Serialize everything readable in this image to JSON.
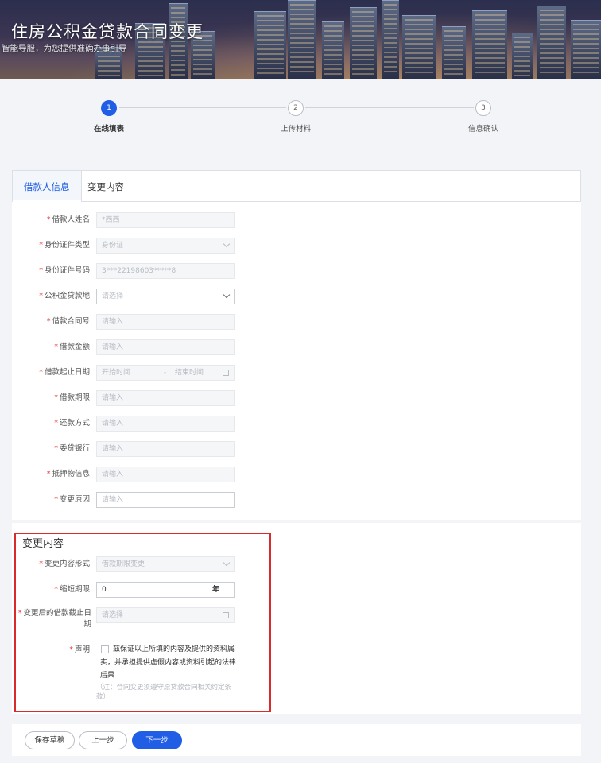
{
  "header": {
    "title": "住房公积金贷款合同变更",
    "subtitle": "智能导服，为您提供准确办事引导"
  },
  "steps": [
    {
      "index": "1",
      "label": "在线填表",
      "state": "active"
    },
    {
      "index": "2",
      "label": "上传材料",
      "state": "pending"
    },
    {
      "index": "3",
      "label": "信息确认",
      "state": "pending"
    }
  ],
  "tabs": [
    {
      "label": "借款人信息",
      "active": true
    },
    {
      "label": "变更内容",
      "active": false
    }
  ],
  "borrower_form": {
    "name": {
      "label": "借款人姓名",
      "value": "*西西"
    },
    "id_type": {
      "label": "身份证件类型",
      "value": "身份证"
    },
    "id_number": {
      "label": "身份证件号码",
      "value": "3***22198603*****8"
    },
    "fund_location": {
      "label": "公积金贷款地",
      "placeholder": "请选择"
    },
    "contract_no": {
      "label": "借款合同号",
      "placeholder": "请输入"
    },
    "loan_amount": {
      "label": "借款金额",
      "placeholder": "请输入"
    },
    "loan_dates": {
      "label": "借款起止日期",
      "start_placeholder": "开始时间",
      "separator": "-",
      "end_placeholder": "结束时间"
    },
    "loan_term": {
      "label": "借款期限",
      "placeholder": "请输入"
    },
    "repay_method": {
      "label": "还款方式",
      "placeholder": "请输入"
    },
    "entrusted_bank": {
      "label": "委贷银行",
      "placeholder": "请输入"
    },
    "collateral": {
      "label": "抵押物信息",
      "placeholder": "请输入"
    },
    "change_reason": {
      "label": "变更原因",
      "placeholder": "请输入"
    }
  },
  "change_section": {
    "title": "变更内容",
    "change_form": {
      "label": "变更内容形式",
      "value": "借款期限变更"
    },
    "shorten_term": {
      "label": "缩短期限",
      "value": "0",
      "unit": "年"
    },
    "new_end_date": {
      "label": "变更后的借款截止日期",
      "placeholder": "请选择"
    },
    "declaration": {
      "label": "声明",
      "text": "兹保证以上所填的内容及提供的资料属实，并承担提供虚假内容或资料引起的法律后果",
      "checked": false,
      "note": "（注：合同变更须遵守原贷款合同相关约定条款）"
    }
  },
  "footer": {
    "save_draft": "保存草稿",
    "prev": "上一步",
    "next": "下一步"
  },
  "colors": {
    "primary": "#1f5ee5",
    "required": "#e53b3b",
    "highlight_border": "#d82c2c"
  }
}
